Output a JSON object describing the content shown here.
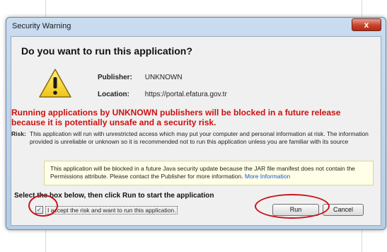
{
  "window": {
    "title": "Security Warning",
    "close_glyph": "x"
  },
  "dialog": {
    "heading": "Do you want to run this application?",
    "publisher_label": "Publisher:",
    "publisher_value": "UNKNOWN",
    "location_label": "Location:",
    "location_value": "https://portal.efatura.gov.tr",
    "red_warning_line1": "Running applications by UNKNOWN publishers will be blocked in a future release",
    "red_warning_line2": "because it is potentially unsafe and a security risk.",
    "risk_label": "Risk:",
    "risk_text": "This application will run with unrestricted access which may put your computer and personal information at risk. The information provided is unreliable or unknown so it is recommended not to run this application unless you are familiar with its source",
    "note_text": "This application will be blocked in a future Java security update because the JAR file manifest does not contain the Permissions attribute. Please contact the Publisher for more information.",
    "note_link": "More Information",
    "select_instruction": "Select the box below, then click Run to start the application",
    "checkbox_label": "I accept the risk and want to run this application.",
    "checkbox_checked": true,
    "run_label": "Run",
    "cancel_label": "Cancel"
  },
  "icons": {
    "warning": "warning-icon",
    "checkbox": "checkmark"
  },
  "colors": {
    "warning_red": "#cc1111",
    "annotation_red": "#c8141a",
    "note_background": "#ffffe8",
    "link_blue": "#1a55c8"
  }
}
